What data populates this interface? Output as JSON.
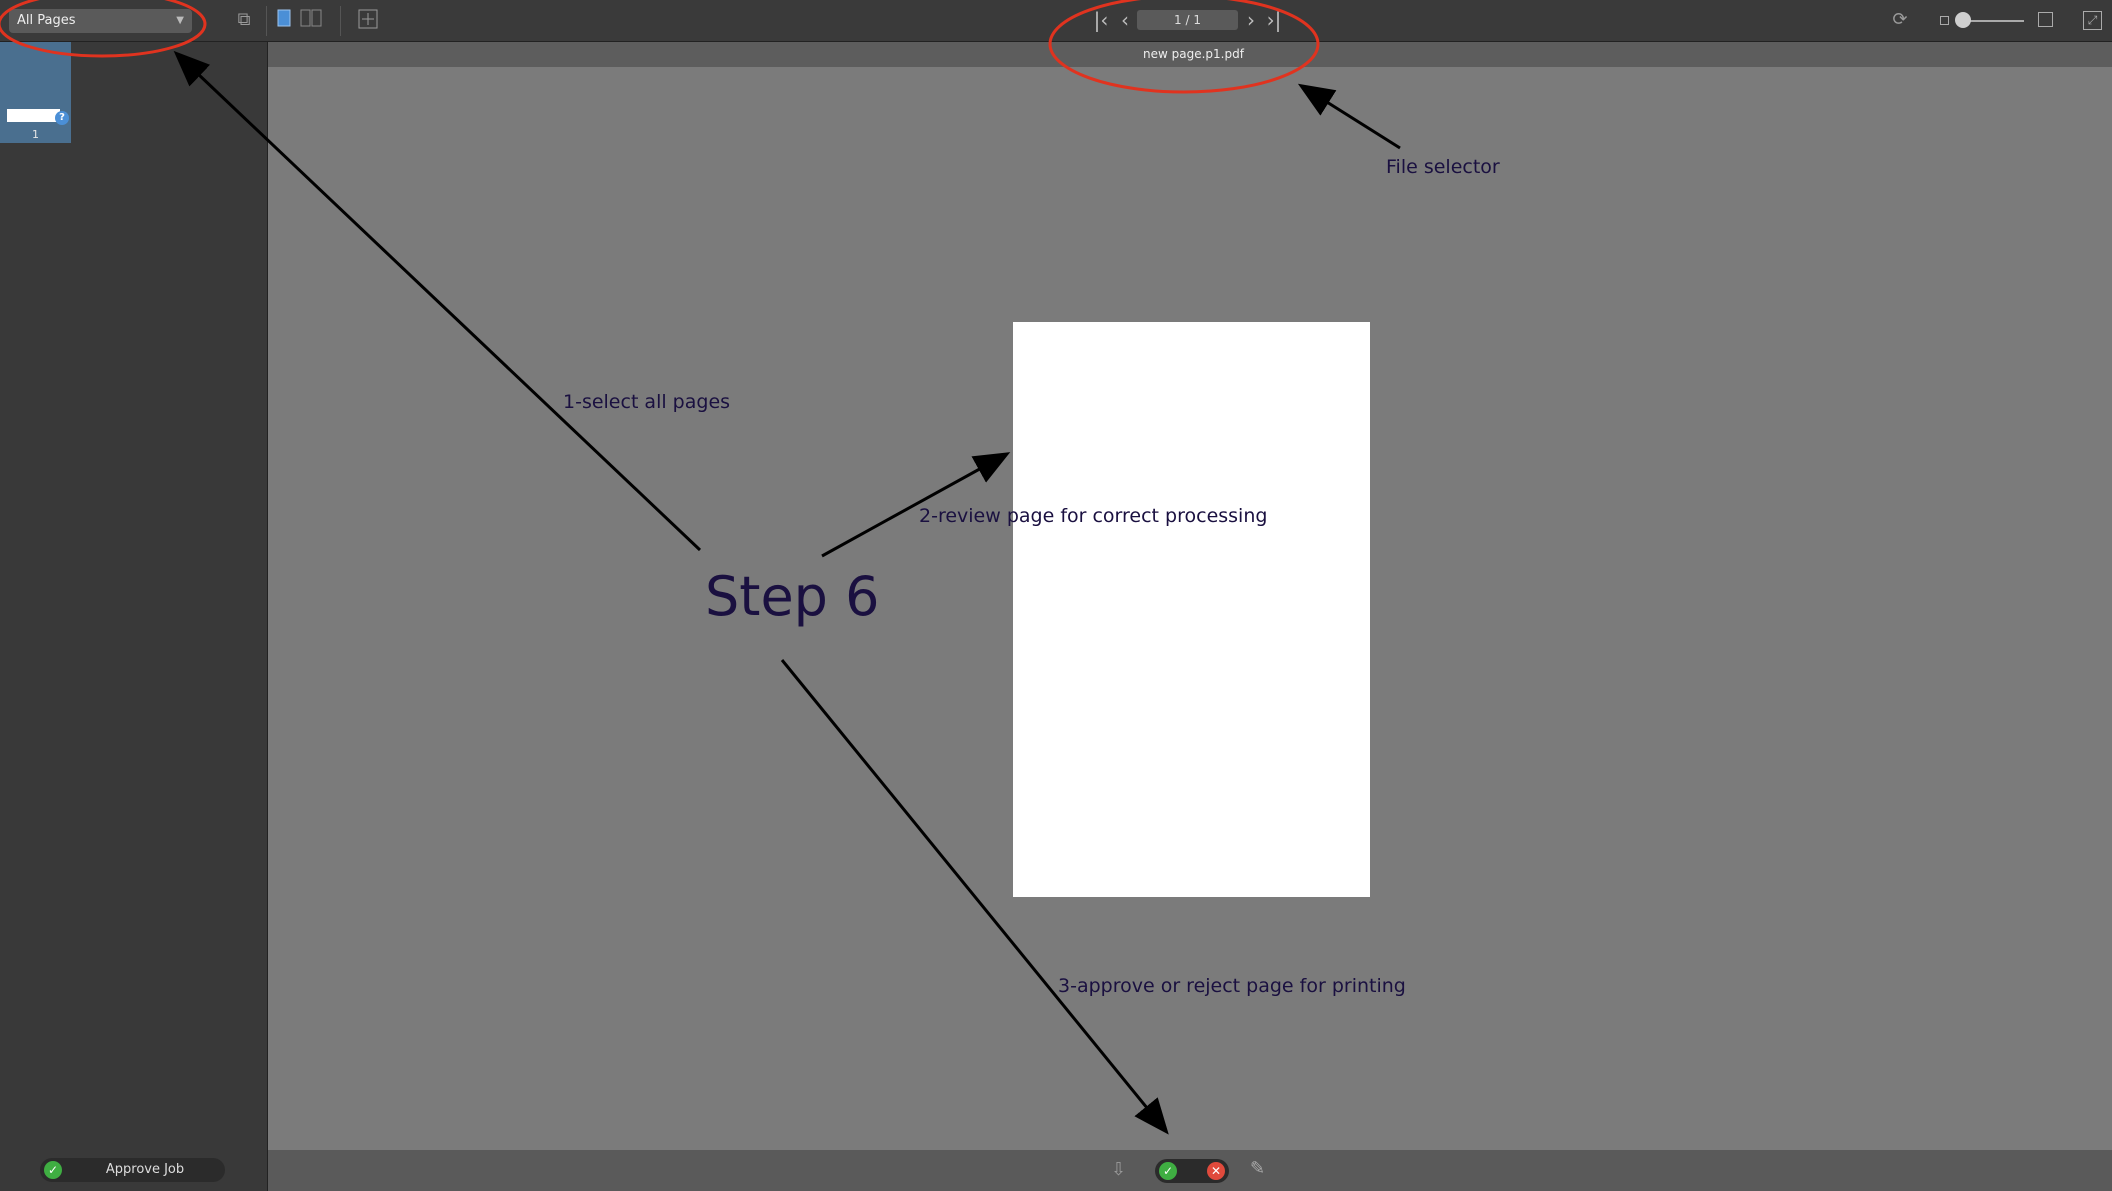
{
  "toolbar": {
    "page_filter": "All Pages",
    "page_indicator": "1 / 1",
    "icons": {
      "sidebar_toggle": "sidebar-toggle-icon",
      "single_page": "single-page-view-icon",
      "two_page": "two-page-view-icon",
      "add_page": "add-page-icon",
      "first": "first-page-icon",
      "prev": "previous-page-icon",
      "next": "next-page-icon",
      "last": "last-page-icon",
      "rotate": "rotate-icon",
      "fullscreen": "fullscreen-icon"
    }
  },
  "sidebar": {
    "thumbnails": [
      {
        "number": "1",
        "badge": "?"
      }
    ],
    "approve_job_label": "Approve Job"
  },
  "document": {
    "file_name": "new page.p1.pdf"
  },
  "annotations": {
    "step_title": "Step 6",
    "note_1": "1-select all pages",
    "note_2": "2-review page for correct processing",
    "note_3": "3-approve or reject page for printing",
    "note_file": "File selector"
  },
  "colors": {
    "toolbar_bg": "#3a3a3a",
    "sidebar_bg": "#393939",
    "canvas_bg": "#7b7b7b",
    "annotation_circle": "#e0331f",
    "approve_green": "#3fae42",
    "reject_red": "#e04a3c"
  }
}
